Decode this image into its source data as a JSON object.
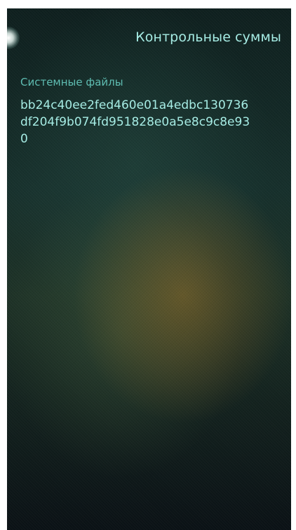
{
  "header": {
    "title": "Контрольные суммы"
  },
  "checksum": {
    "label": "Системные файлы",
    "lines": [
      "bb24c40ee2fed460e01a4edbc130736",
      "df204f9b074fd951828e0a5e8c9c8e93",
      "0"
    ]
  },
  "colors": {
    "primary_text": "#a6ece4",
    "secondary_text": "#5fbdb2",
    "background": "#15282a"
  },
  "icons": {
    "pulley_indicator": "pulley-menu-glow-icon"
  }
}
